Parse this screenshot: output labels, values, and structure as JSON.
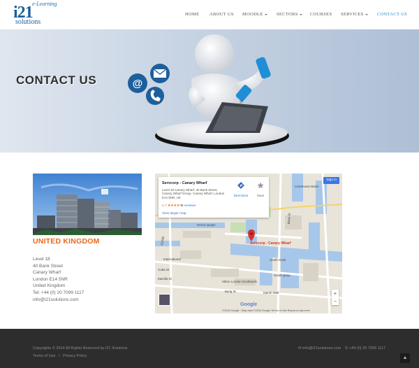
{
  "logo": {
    "tagline": "e-Learning",
    "mark": "i21",
    "wordmark": "solutions"
  },
  "nav": {
    "items": [
      {
        "label": "HOME"
      },
      {
        "label": "ABOUT US"
      },
      {
        "label": "MOODLE"
      },
      {
        "label": "SECTORS"
      },
      {
        "label": "COURSES"
      },
      {
        "label": "SERVICES"
      },
      {
        "label": "CONTACT US"
      }
    ],
    "active": "CONTACT US"
  },
  "hero": {
    "title": "CONTACT US"
  },
  "office": {
    "country": "UNITED KINGDOM",
    "address_lines": [
      "Level 18",
      "40 Bank Street",
      "Canary Wharf",
      "London E14 5NR",
      "United Kingdom"
    ],
    "phone": "Tel: +44 (0) 20 7099 1117",
    "email": "info@i21solutions.com"
  },
  "map": {
    "place_name": "Servcorp - Canary Wharf",
    "place_address": "Level 18 Canary Wharf, 40 Bank Street, Canary Wharf Group, Canary Wharf, London E14 5NR, UK",
    "rating": "4.7 ★★★★★",
    "reviews": "5 reviews",
    "larger_map": "View larger map",
    "directions": "Directions",
    "save": "Save",
    "sign_in": "Sign in",
    "marker_label": "Servcorp - Canary Wharf",
    "labels": {
      "south_quay": "South Quay",
      "heron_quays": "Heron Quays",
      "bank_st": "Bank St",
      "cuba_st": "Cuba St",
      "manilla_st": "Manilla St",
      "byng_st": "Byng St",
      "marsh_wall": "Marsh Wall",
      "south_dock": "South Dock",
      "international": "International",
      "hilton": "Hilton London Docklands",
      "a1206": "A1206",
      "limehouse": "Limehouse Basin"
    },
    "attribution": "©2016 Google - Map data ©2016 Google   Terms of Use   Report a map error",
    "google": "Google"
  },
  "footer": {
    "copyright": "Copyrights © 2014 All Rights Reserved by i21 Solutions",
    "terms": "Terms of Use",
    "separator": "/",
    "privacy": "Privacy Policy",
    "email": "info@i21solutions.com",
    "phone": "+44 (0) 20 7099 1117",
    "to_top": "▲"
  },
  "colors": {
    "accent": "#2a86c6",
    "country": "#e8681e",
    "footer_bg": "#2d2d2d"
  }
}
